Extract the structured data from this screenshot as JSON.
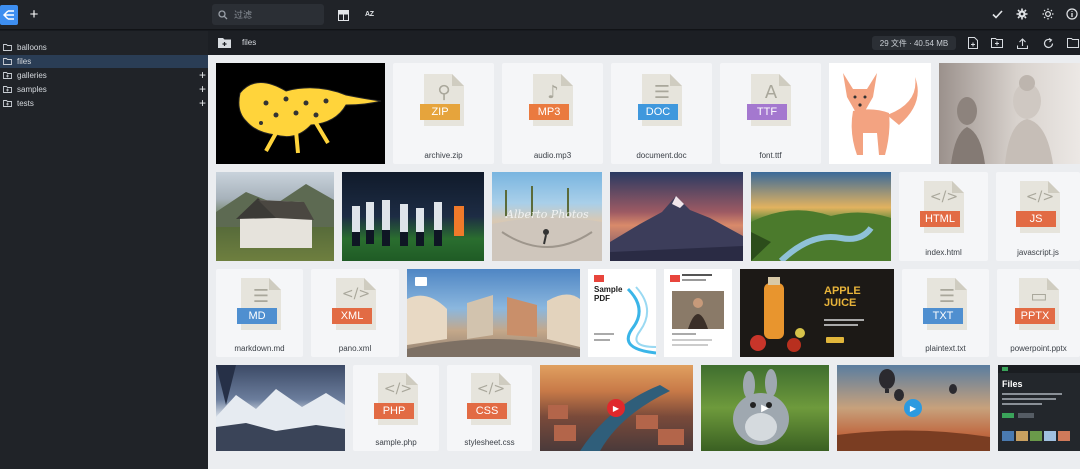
{
  "topbar": {
    "search_placeholder": "过滤",
    "sort_label": "A Z"
  },
  "sidebar": {
    "items": [
      {
        "label": "balloons",
        "has_add": false
      },
      {
        "label": "files",
        "has_add": false
      },
      {
        "label": "galleries",
        "has_add": true
      },
      {
        "label": "samples",
        "has_add": true
      },
      {
        "label": "tests",
        "has_add": true
      }
    ]
  },
  "breadcrumb": {
    "folder": "files",
    "stats": "29 文件 · 40.54 MB"
  },
  "files": {
    "archive": {
      "name": "archive.zip",
      "ext": "ZIP",
      "color": "#e6a43c"
    },
    "audio": {
      "name": "audio.mp3",
      "ext": "MP3",
      "color": "#ea7a3f"
    },
    "document": {
      "name": "document.doc",
      "ext": "DOC",
      "color": "#3f98dd"
    },
    "font": {
      "name": "font.ttf",
      "ext": "TTF",
      "color": "#a478cf"
    },
    "index": {
      "name": "index.html",
      "ext": "HTML",
      "color": "#e26b44"
    },
    "javascript": {
      "name": "javascript.js",
      "ext": "JS",
      "color": "#e26b44"
    },
    "markdown": {
      "name": "markdown.md",
      "ext": "MD",
      "color": "#4f8fd0"
    },
    "pano": {
      "name": "pano.xml",
      "ext": "XML",
      "color": "#e26b44"
    },
    "plaintext": {
      "name": "plaintext.txt",
      "ext": "TXT",
      "color": "#4f8fd0"
    },
    "powerpoint": {
      "name": "powerpoint.pptx",
      "ext": "PPTX",
      "color": "#e26b44"
    },
    "php": {
      "name": "sample.php",
      "ext": "PHP",
      "color": "#e26b44"
    },
    "stylesheet": {
      "name": "stylesheet.css",
      "ext": "CSS",
      "color": "#e26b44"
    }
  },
  "thumb_text": {
    "watermark": "Alberto Photos",
    "pdf1_title": "Sample PDF",
    "juice_title": "APPLE JUICE",
    "screen_title": "Files"
  }
}
